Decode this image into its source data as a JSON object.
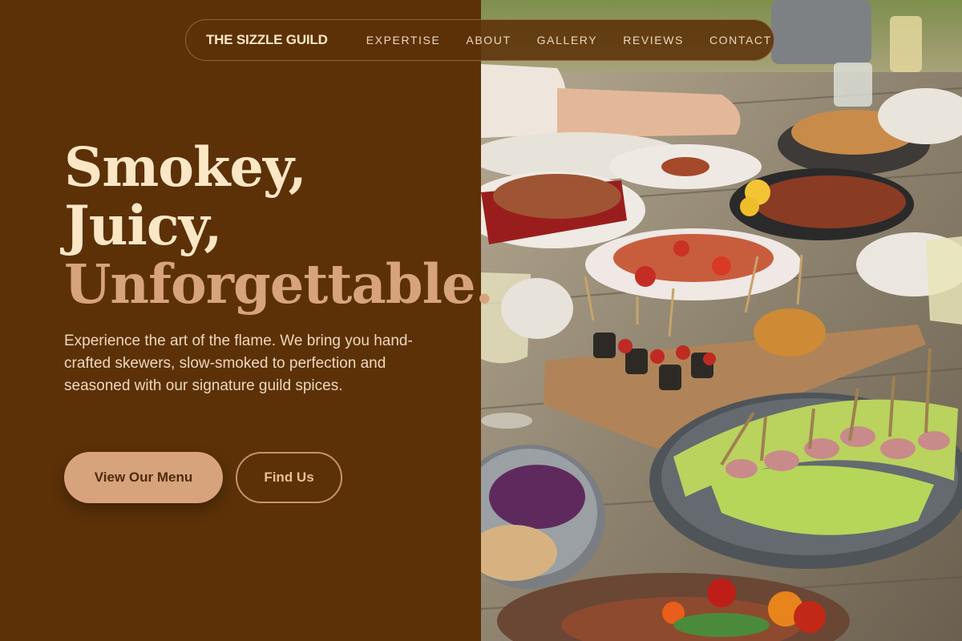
{
  "nav": {
    "brand": "THE SIZZLE GUILD",
    "links": [
      "EXPERTISE",
      "ABOUT",
      "GALLERY",
      "REVIEWS",
      "CONTACT"
    ]
  },
  "hero": {
    "headline_line1": "Smokey,",
    "headline_line2": "Juicy,",
    "headline_line3": "Unforgettable.",
    "description": "Experience the art of the flame. We bring you hand-crafted skewers, slow-smoked to perfection and seasoned with our signature guild spices.",
    "primary_cta": "View Our Menu",
    "secondary_cta": "Find Us"
  },
  "colors": {
    "background": "#5c3108",
    "cream": "#fbe7c6",
    "accent": "#d7a37d"
  }
}
